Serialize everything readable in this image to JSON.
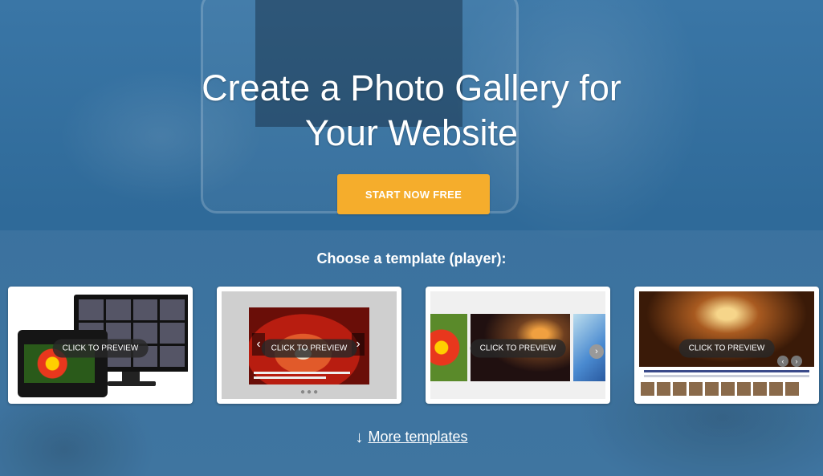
{
  "hero": {
    "title_line1": "Create a Photo Gallery for",
    "title_line2": "Your Website",
    "cta_label": "START NOW FREE"
  },
  "templates": {
    "heading": "Choose a template (player):",
    "items": [
      {
        "preview_label": "CLICK TO PREVIEW"
      },
      {
        "preview_label": "CLICK TO PREVIEW"
      },
      {
        "preview_label": "CLICK TO PREVIEW"
      },
      {
        "preview_label": "CLICK TO PREVIEW"
      }
    ]
  },
  "more": {
    "icon": "arrow-down-icon",
    "label": "More templates"
  },
  "colors": {
    "background": "#2e6694",
    "cta": "#f5ad2c",
    "text": "#ffffff"
  }
}
